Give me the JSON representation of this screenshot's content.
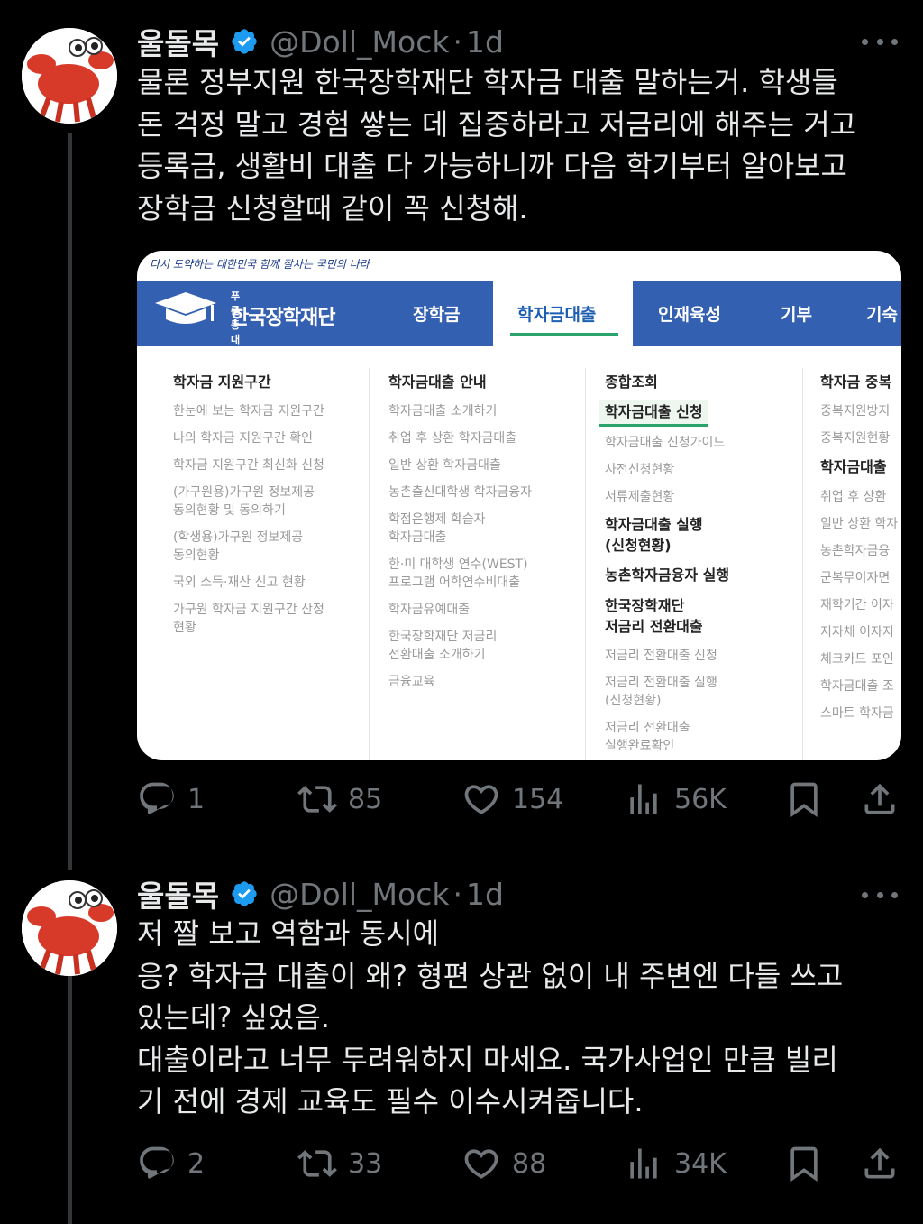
{
  "tweets": [
    {
      "display_name": "울돌목",
      "handle": "@Doll_Mock",
      "time": "1d",
      "text_lines": [
        "물론 정부지원 한국장학재단 학자금 대출 말하는거. 학생들",
        "돈 걱정 말고 경험 쌓는 데 집중하라고 저금리에 해주는 거고",
        "등록금, 생활비 대출 다 가능하니까 다음 학기부터 알아보고",
        "장학금 신청할때 같이 꼭 신청해."
      ],
      "replies": "1",
      "reposts": "85",
      "likes": "154",
      "views": "56K"
    },
    {
      "display_name": "울돌목",
      "handle": "@Doll_Mock",
      "time": "1d",
      "text_lines": [
        "저 짤 보고 역함과 동시에",
        "응? 학자금 대출이 왜? 형편 상관 없이 내 주변엔 다들 쓰고",
        "있는데? 싶었음.",
        "대출이라고 너무 두려워하지 마세요. 국가사업인 만큼 빌리",
        "기 전에 경제 교육도 필수 이수시켜줍니다."
      ],
      "replies": "2",
      "reposts": "33",
      "likes": "88",
      "views": "34K"
    }
  ],
  "media": {
    "slogan": "다시 도약하는 대한민국 함께 잘사는 국민의 나라",
    "logo_sub": "푸른등대",
    "logo_name": "한국장학재단",
    "nav": [
      "장학금",
      "학자금대출",
      "인재육성",
      "기부",
      "기숙"
    ],
    "columns": [
      {
        "items": [
          {
            "t": "h",
            "text": "학자금 지원구간"
          },
          {
            "t": "i",
            "text": "한눈에 보는 학자금 지원구간"
          },
          {
            "t": "i",
            "text": "나의 학자금 지원구간 확인"
          },
          {
            "t": "i",
            "text": "학자금 지원구간 최신화 신청"
          },
          {
            "t": "i",
            "text": "(가구원용)가구원 정보제공"
          },
          {
            "t": "i",
            "text": "동의현황 및 동의하기"
          },
          {
            "t": "i",
            "text": "(학생용)가구원 정보제공"
          },
          {
            "t": "i",
            "text": "동의현황"
          },
          {
            "t": "i",
            "text": "국외 소득·재산 신고 현황"
          },
          {
            "t": "i",
            "text": "가구원 학자금 지원구간 산정"
          },
          {
            "t": "i",
            "text": "현황"
          }
        ]
      },
      {
        "items": [
          {
            "t": "h",
            "text": "학자금대출 안내"
          },
          {
            "t": "i",
            "text": "학자금대출 소개하기"
          },
          {
            "t": "i",
            "text": "취업 후 상환 학자금대출"
          },
          {
            "t": "i",
            "text": "일반 상환 학자금대출"
          },
          {
            "t": "i",
            "text": "농촌출신대학생 학자금융자"
          },
          {
            "t": "i",
            "text": "학점은행제 학습자"
          },
          {
            "t": "i",
            "text": "학자금대출"
          },
          {
            "t": "i",
            "text": "한·미 대학생 연수(WEST)"
          },
          {
            "t": "i",
            "text": "프로그램 어학연수비대출"
          },
          {
            "t": "i",
            "text": "학자금유예대출"
          },
          {
            "t": "i",
            "text": "한국장학재단 저금리"
          },
          {
            "t": "i",
            "text": "전환대출 소개하기"
          },
          {
            "t": "i",
            "text": "금융교육"
          }
        ]
      },
      {
        "items": [
          {
            "t": "h",
            "text": "종합조회"
          },
          {
            "t": "hl",
            "text": "학자금대출 신청"
          },
          {
            "t": "i",
            "text": "학자금대출 신청가이드"
          },
          {
            "t": "i",
            "text": "사전신청현황"
          },
          {
            "t": "i",
            "text": "서류제출현황"
          },
          {
            "t": "h",
            "text": "학자금대출 실행"
          },
          {
            "t": "h",
            "text": "(신청현황)"
          },
          {
            "t": "h",
            "text": "농촌학자금융자 실행"
          },
          {
            "t": "h",
            "text": "한국장학재단"
          },
          {
            "t": "h",
            "text": "저금리 전환대출"
          },
          {
            "t": "i",
            "text": "저금리 전환대출 신청"
          },
          {
            "t": "i",
            "text": "저금리 전환대출 실행"
          },
          {
            "t": "i",
            "text": "(신청현황)"
          },
          {
            "t": "i",
            "text": "저금리 전환대출"
          },
          {
            "t": "i",
            "text": "실행완료확인"
          }
        ]
      },
      {
        "items": [
          {
            "t": "h",
            "text": "학자금 중복"
          },
          {
            "t": "i",
            "text": "중복지원방지"
          },
          {
            "t": "i",
            "text": "중복지원현황"
          },
          {
            "t": "h",
            "text": "학자금대출"
          },
          {
            "t": "i",
            "text": "취업 후 상환"
          },
          {
            "t": "i",
            "text": "일반 상환 학자"
          },
          {
            "t": "i",
            "text": "농촌학자금융"
          },
          {
            "t": "i",
            "text": "군복무이자면"
          },
          {
            "t": "i",
            "text": "재학기간 이자"
          },
          {
            "t": "i",
            "text": "지자체 이자지"
          },
          {
            "t": "i",
            "text": "체크카드 포인"
          },
          {
            "t": "i",
            "text": "학자금대출 조"
          },
          {
            "t": "i",
            "text": "스마트 학자금"
          }
        ]
      }
    ]
  },
  "colors": {
    "background": "#000000",
    "text": "#e7e9ea",
    "secondary": "#71767b",
    "verified": "#1d9bf0",
    "nav_blue": "#3460b1",
    "accent_green": "#2aa36b"
  }
}
